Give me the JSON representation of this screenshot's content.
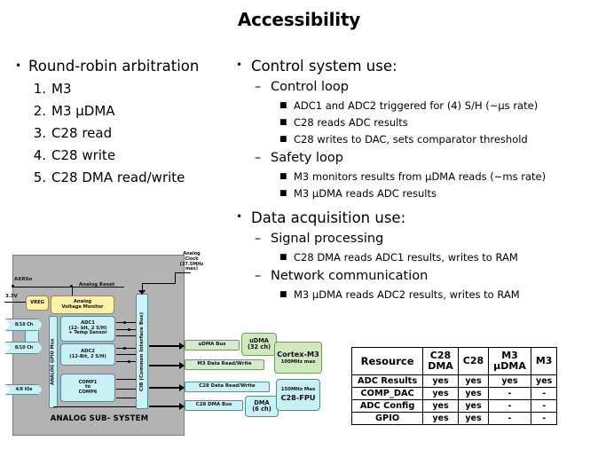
{
  "slide": {
    "title": "Accessibility"
  },
  "left_column": {
    "heading": "Round-robin arbitration",
    "items": [
      {
        "num": "1.",
        "label": "M3"
      },
      {
        "num": "2.",
        "label": "M3 µDMA"
      },
      {
        "num": "3.",
        "label": "C28 read"
      },
      {
        "num": "4.",
        "label": "C28 write"
      },
      {
        "num": "5.",
        "label": "C28 DMA read/write"
      }
    ]
  },
  "right_column": {
    "sections": [
      {
        "heading": "Control system use:",
        "groups": [
          {
            "label": "Control loop",
            "points": [
              "ADC1 and ADC2 triggered for (4) S/H (~µs rate)",
              "C28 reads ADC results",
              "C28 writes to DAC, sets comparator threshold"
            ]
          },
          {
            "label": "Safety loop",
            "points": [
              "M3 monitors results from µDMA reads (~ms rate)",
              "M3 µDMA reads ADC results"
            ]
          }
        ]
      },
      {
        "heading": "Data acquisition use:",
        "groups": [
          {
            "label": "Signal processing",
            "points": [
              "C28 DMA reads ADC1 results, writes to RAM"
            ]
          },
          {
            "label": "Network communication",
            "points": [
              "M3 µDMA reads ADC2 results, writes to RAM"
            ]
          }
        ]
      }
    ]
  },
  "diagram": {
    "subsystem_label": "ANALOG SUB- SYSTEM",
    "signals": {
      "axrsn": "AXRSn",
      "analog_reset": "Analog Reset",
      "supply": "3.3V",
      "analog_clock": "Analog\nClock\n(37.5MHz\nmax)"
    },
    "blocks": {
      "vreg": "VREG",
      "avm": "Analog\nVoltage Monitor",
      "adc1": "ADC1\n(12- bit, 2 S/H)\n+ Temp Sensor",
      "adc2": "ADC2\n(12-Bit, 2 S/H)",
      "comp": "COMP1\nto\nCOMP6",
      "gpio_mux": "ANALOG GPIO Mux",
      "cib": "CIB (Common Interface Bus)",
      "udma": "uDMA\n(32 ch)",
      "cortex_m3": "Cortex-M3",
      "cortex_m3_speed": "100MHz max",
      "dma": "DMA\n(6 ch)",
      "c28_fpu": "C28-FPU",
      "c28_speed": "150MHz Max"
    },
    "buses": {
      "udma_bus": "uDMA Bus",
      "m3_rw": "M3 Data Read/Write",
      "c28_rw": "C28 Data Read/Write",
      "c28_dma_bus": "C28 DMA Bus"
    },
    "ports": {
      "ch_top": "8/10 Ch",
      "ch_bottom": "8/10 Ch",
      "ios": "4/8 IOs"
    }
  },
  "table": {
    "headers": [
      "Resource",
      "C28\nDMA",
      "C28",
      "M3\nµDMA",
      "M3"
    ],
    "header_parts": [
      [
        "Resource",
        ""
      ],
      [
        "C28",
        "DMA"
      ],
      [
        "C28",
        ""
      ],
      [
        "M3",
        "µDMA"
      ],
      [
        "M3",
        ""
      ]
    ],
    "rows": [
      {
        "resource": "ADC Results",
        "cells": [
          "yes",
          "yes",
          "yes",
          "yes"
        ]
      },
      {
        "resource": "COMP_DAC",
        "cells": [
          "yes",
          "yes",
          "-",
          "-"
        ]
      },
      {
        "resource": "ADC Config",
        "cells": [
          "yes",
          "yes",
          "-",
          "-"
        ]
      },
      {
        "resource": "GPIO",
        "cells": [
          "yes",
          "yes",
          "-",
          "-"
        ]
      }
    ]
  },
  "colors": {
    "yellow_block": "#fff2a8",
    "cyan_block": "#c9f0f5",
    "green_block": "#cfe8c0",
    "diagram_bg": "#b3b3b3"
  }
}
